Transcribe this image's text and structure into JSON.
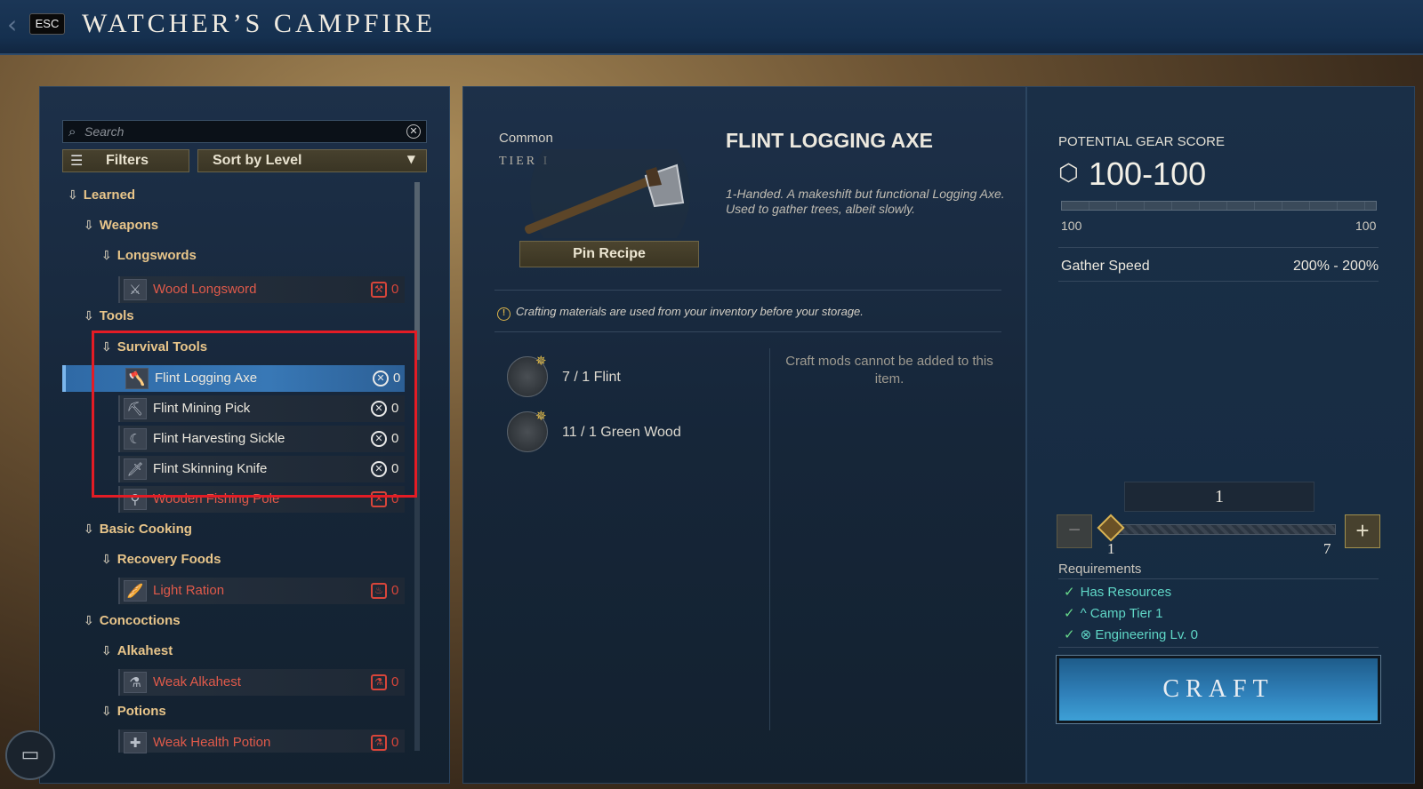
{
  "header": {
    "esc_label": "ESC",
    "title": "WATCHER’S CAMPFIRE"
  },
  "search": {
    "placeholder": "Search"
  },
  "toolbar": {
    "filters_label": "Filters",
    "sort_label": "Sort by Level"
  },
  "tree": {
    "learned": "Learned",
    "weapons": "Weapons",
    "longswords": "Longswords",
    "tools": "Tools",
    "survival_tools": "Survival Tools",
    "basic_cooking": "Basic Cooking",
    "recovery_foods": "Recovery Foods",
    "concoctions": "Concoctions",
    "alkahest": "Alkahest",
    "potions": "Potions",
    "items": [
      {
        "name": "Wood Longsword",
        "qty": "0"
      },
      {
        "name": "Flint Logging Axe",
        "qty": "0"
      },
      {
        "name": "Flint Mining Pick",
        "qty": "0"
      },
      {
        "name": "Flint Harvesting Sickle",
        "qty": "0"
      },
      {
        "name": "Flint Skinning Knife",
        "qty": "0"
      },
      {
        "name": "Wooden Fishing Pole",
        "qty": "0"
      },
      {
        "name": "Light Ration",
        "qty": "0"
      },
      {
        "name": "Weak Alkahest",
        "qty": "0"
      },
      {
        "name": "Weak Health Potion",
        "qty": "0"
      }
    ]
  },
  "item": {
    "rarity": "Common",
    "tier": "TIER I",
    "name": "FLINT LOGGING AXE",
    "description": "1-Handed. A makeshift but functional Logging Axe. Used to gather trees, albeit slowly.",
    "pin_label": "Pin Recipe",
    "info_note": "Crafting materials are used from your inventory before your storage.",
    "materials": [
      {
        "text": "7 / 1 Flint"
      },
      {
        "text": "11 / 1 Green Wood"
      }
    ],
    "mods_note": "Craft mods cannot be added to this item."
  },
  "gear": {
    "label": "POTENTIAL GEAR SCORE",
    "value": "100-100",
    "min": "100",
    "max": "100",
    "stat_label": "Gather Speed",
    "stat_value": "200% - 200%"
  },
  "craft": {
    "quantity": "1",
    "slider_min": "1",
    "slider_max": "7",
    "requirements_label": "Requirements",
    "requirements": [
      "Has Resources",
      "Camp Tier 1",
      "Engineering Lv. 0"
    ],
    "button_label": "CRAFT"
  },
  "colors": {
    "accent_blue": "#3878b6",
    "unavailable_red": "#e05a4a",
    "category_gold": "#e8c58a",
    "requirement_teal": "#5fd6c6",
    "highlight_red": "#e31c25"
  }
}
